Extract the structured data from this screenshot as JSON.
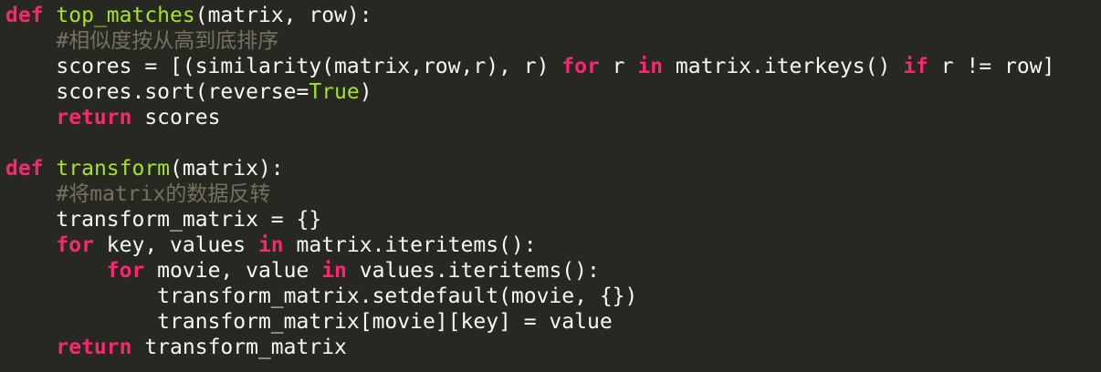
{
  "editor": {
    "lines": [
      [
        {
          "t": "def",
          "c": "kw"
        },
        {
          "t": " ",
          "c": "plain"
        },
        {
          "t": "top_matches",
          "c": "fn"
        },
        {
          "t": "(matrix, row):",
          "c": "plain"
        }
      ],
      [
        {
          "t": "    ",
          "c": "plain"
        },
        {
          "t": "#相似度按从高到底排序",
          "c": "cm"
        }
      ],
      [
        {
          "t": "    scores = [(similarity(matrix,row,r), r) ",
          "c": "plain"
        },
        {
          "t": "for",
          "c": "kw"
        },
        {
          "t": " r ",
          "c": "plain"
        },
        {
          "t": "in",
          "c": "kw"
        },
        {
          "t": " matrix.iterkeys() ",
          "c": "plain"
        },
        {
          "t": "if",
          "c": "kw"
        },
        {
          "t": " r != row]",
          "c": "plain"
        }
      ],
      [
        {
          "t": "    scores.sort(reverse=",
          "c": "plain"
        },
        {
          "t": "True",
          "c": "const"
        },
        {
          "t": ")",
          "c": "plain"
        }
      ],
      [
        {
          "t": "    ",
          "c": "plain"
        },
        {
          "t": "return",
          "c": "kw"
        },
        {
          "t": " scores",
          "c": "plain"
        }
      ],
      [],
      [
        {
          "t": "def",
          "c": "kw"
        },
        {
          "t": " ",
          "c": "plain"
        },
        {
          "t": "transform",
          "c": "fn"
        },
        {
          "t": "(matrix):",
          "c": "plain"
        }
      ],
      [
        {
          "t": "    ",
          "c": "plain"
        },
        {
          "t": "#将matrix的数据反转",
          "c": "cm"
        }
      ],
      [
        {
          "t": "    transform_matrix = {}",
          "c": "plain"
        }
      ],
      [
        {
          "t": "    ",
          "c": "plain"
        },
        {
          "t": "for",
          "c": "kw"
        },
        {
          "t": " key, values ",
          "c": "plain"
        },
        {
          "t": "in",
          "c": "kw"
        },
        {
          "t": " matrix.iteritems():",
          "c": "plain"
        }
      ],
      [
        {
          "t": "        ",
          "c": "plain"
        },
        {
          "t": "for",
          "c": "kw"
        },
        {
          "t": " movie, value ",
          "c": "plain"
        },
        {
          "t": "in",
          "c": "kw"
        },
        {
          "t": " values.iteritems():",
          "c": "plain"
        }
      ],
      [
        {
          "t": "            transform_matrix.setdefault(movie, {})",
          "c": "plain"
        }
      ],
      [
        {
          "t": "            transform_matrix[movie][key] = value",
          "c": "plain"
        }
      ],
      [
        {
          "t": "    ",
          "c": "plain"
        },
        {
          "t": "return",
          "c": "kw"
        },
        {
          "t": " transform_matrix",
          "c": "plain"
        }
      ]
    ]
  },
  "colors": {
    "background": "#272822",
    "keyword": "#f92672",
    "function_name": "#a6e22e",
    "constant": "#a6e22e",
    "comment": "#75715e",
    "text": "#f8f8f2"
  }
}
